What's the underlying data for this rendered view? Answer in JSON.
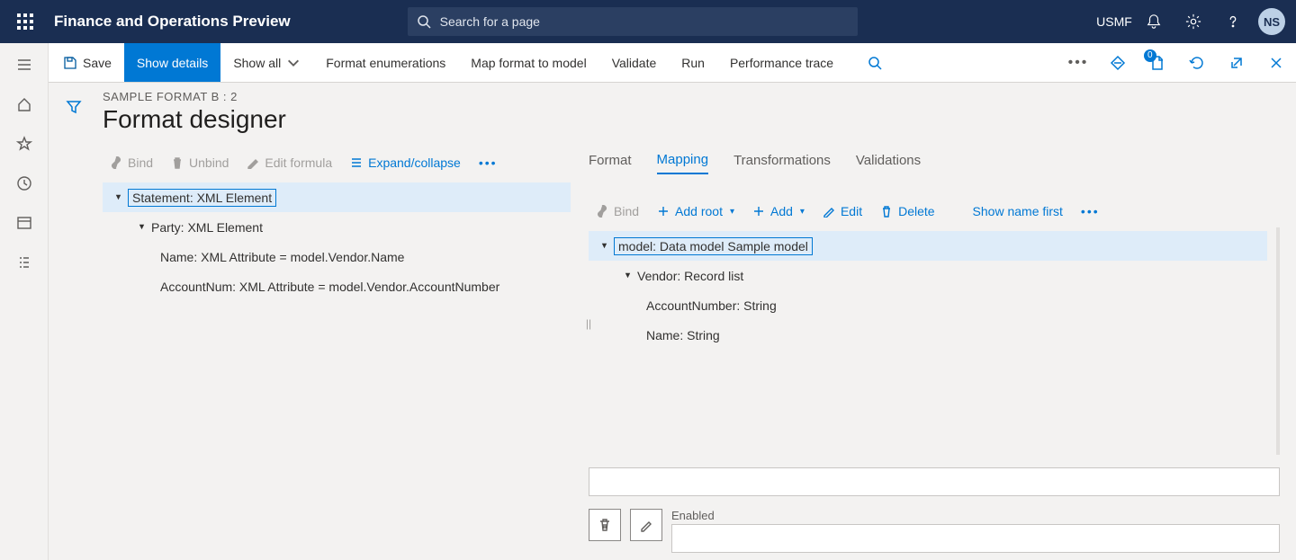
{
  "topbar": {
    "app_title": "Finance and Operations Preview",
    "search_placeholder": "Search for a page",
    "company": "USMF",
    "avatar": "NS"
  },
  "actionbar": {
    "save": "Save",
    "show_details": "Show details",
    "show_all": "Show all",
    "format_enum": "Format enumerations",
    "map_format": "Map format to model",
    "validate": "Validate",
    "run": "Run",
    "perf_trace": "Performance trace",
    "badge_count": "0"
  },
  "page": {
    "breadcrumb": "SAMPLE FORMAT B : 2",
    "title": "Format designer"
  },
  "left_toolbar": {
    "bind": "Bind",
    "unbind": "Unbind",
    "edit_formula": "Edit formula",
    "expand_collapse": "Expand/collapse"
  },
  "left_tree": [
    {
      "level": 0,
      "label": "Statement: XML Element",
      "selected": true,
      "expandable": true
    },
    {
      "level": 1,
      "label": "Party: XML Element",
      "expandable": true
    },
    {
      "level": 2,
      "label": "Name: XML Attribute = model.Vendor.Name"
    },
    {
      "level": 2,
      "label": "AccountNum: XML Attribute = model.Vendor.AccountNumber"
    }
  ],
  "right_tabs": {
    "format": "Format",
    "mapping": "Mapping",
    "transformations": "Transformations",
    "validations": "Validations"
  },
  "right_toolbar": {
    "bind": "Bind",
    "add_root": "Add root",
    "add": "Add",
    "edit": "Edit",
    "delete": "Delete",
    "show_name_first": "Show name first"
  },
  "right_tree": [
    {
      "level": 0,
      "label": "model: Data model Sample model",
      "selected": true,
      "expandable": true
    },
    {
      "level": 1,
      "label": "Vendor: Record list",
      "expandable": true
    },
    {
      "level": 2,
      "label": "AccountNumber: String"
    },
    {
      "level": 2,
      "label": "Name: String"
    }
  ],
  "right_fields": {
    "enabled_label": "Enabled",
    "path_value": "",
    "enabled_value": ""
  }
}
